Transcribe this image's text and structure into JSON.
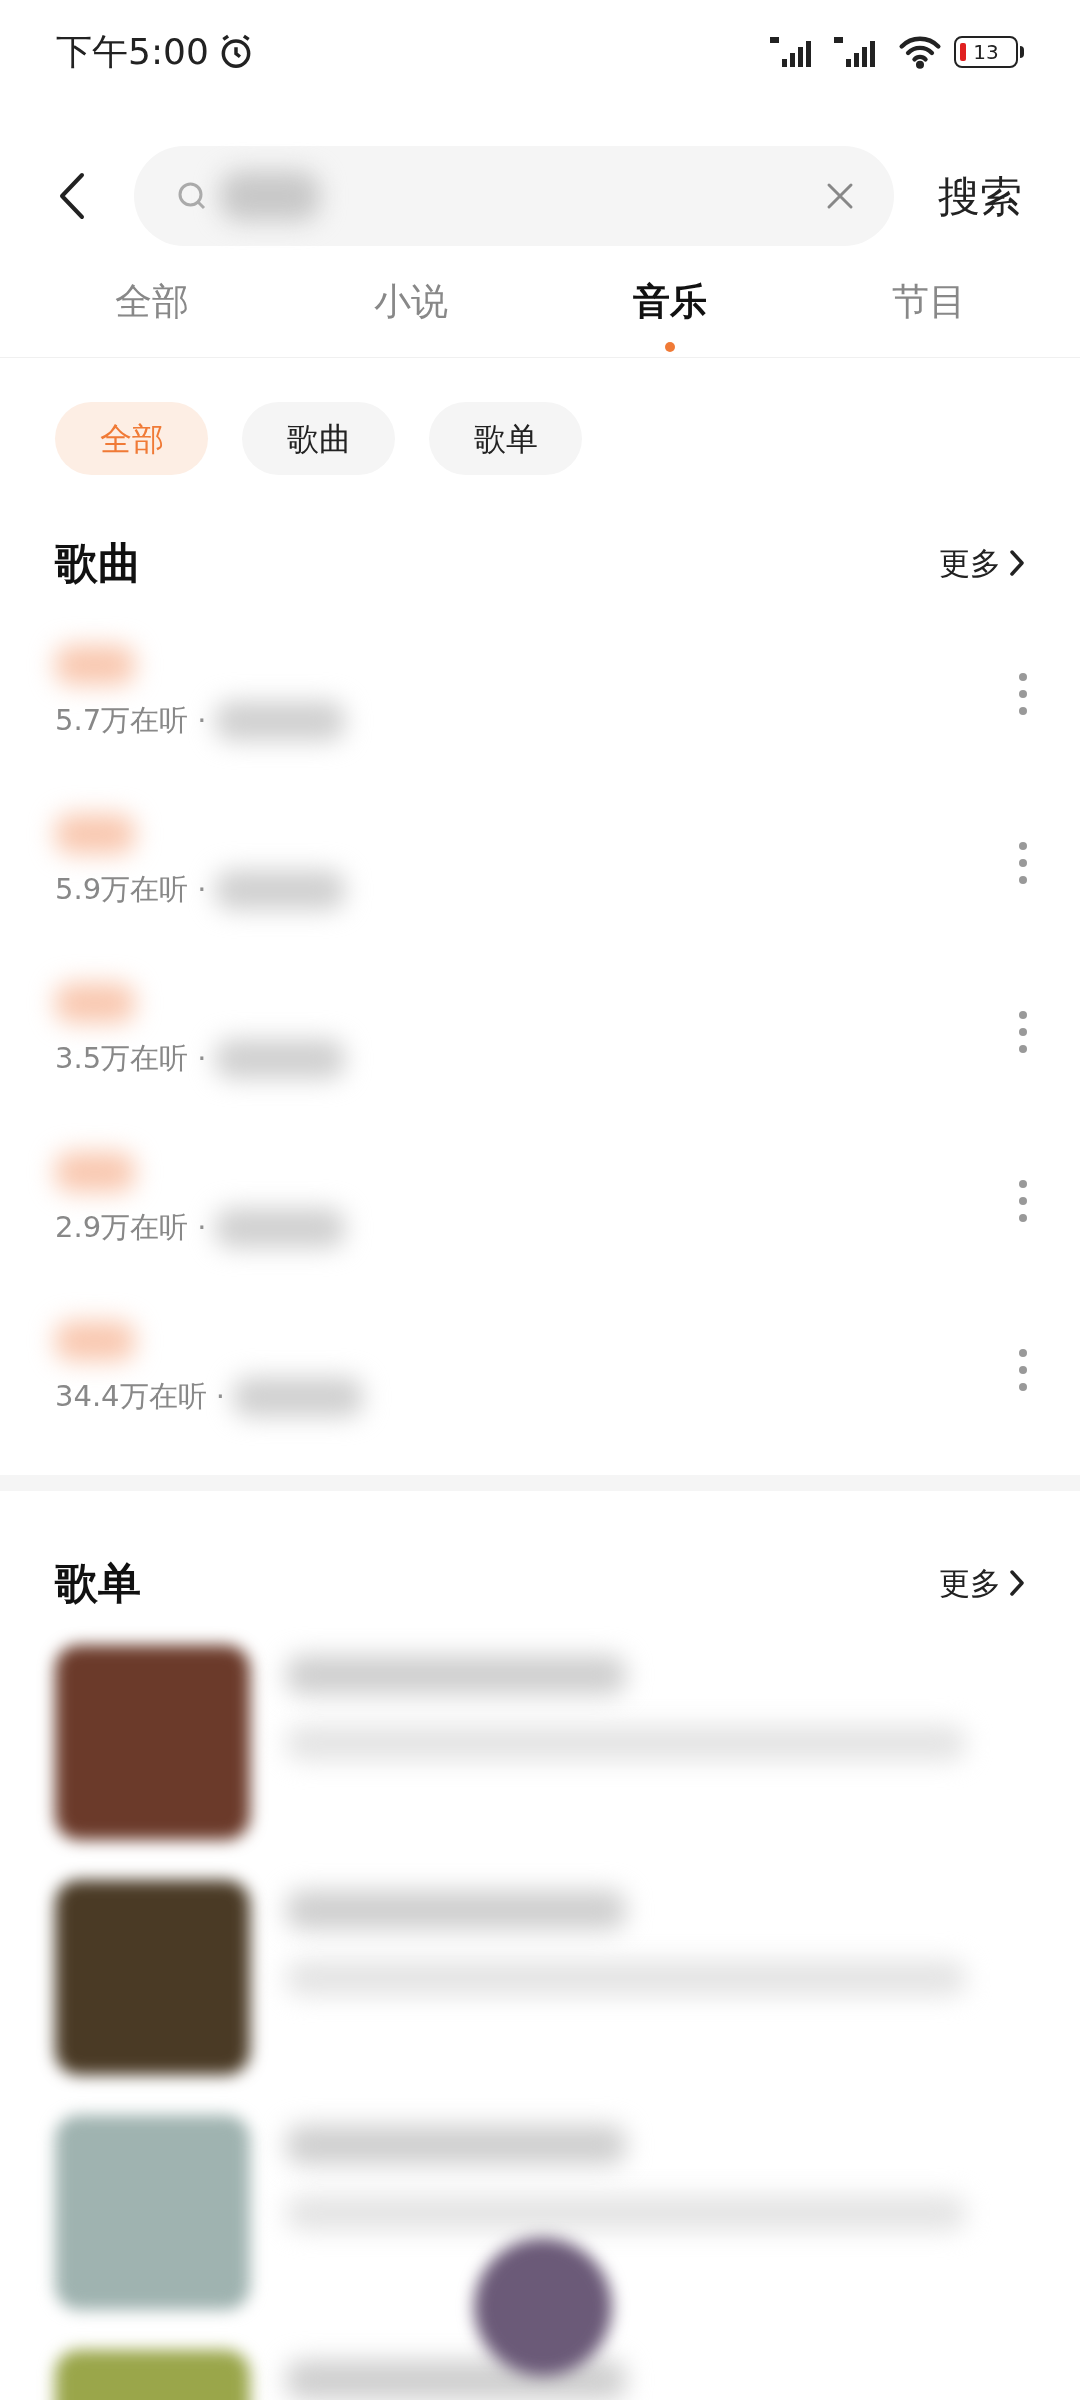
{
  "status_bar": {
    "time": "下午5:00",
    "battery": "13"
  },
  "search": {
    "button": "搜索"
  },
  "tabs": [
    {
      "label": "全部",
      "selected": false
    },
    {
      "label": "小说",
      "selected": false
    },
    {
      "label": "音乐",
      "selected": true
    },
    {
      "label": "节目",
      "selected": false
    }
  ],
  "chips": [
    {
      "label": "全部",
      "selected": true
    },
    {
      "label": "歌曲",
      "selected": false
    },
    {
      "label": "歌单",
      "selected": false
    }
  ],
  "songs_section": {
    "title": "歌曲",
    "more": "更多"
  },
  "songs": [
    {
      "listeners": "5.7万在听 ·"
    },
    {
      "listeners": "5.9万在听 ·"
    },
    {
      "listeners": "3.5万在听 ·"
    },
    {
      "listeners": "2.9万在听 ·"
    },
    {
      "listeners": "34.4万在听 ·"
    }
  ],
  "playlists_section": {
    "title": "歌单",
    "more": "更多"
  },
  "playlists": [
    {
      "color": "#6b3a2a"
    },
    {
      "color": "#4a3a25"
    },
    {
      "color": "#9fb3b0"
    },
    {
      "color": "#9aa64a"
    }
  ]
}
